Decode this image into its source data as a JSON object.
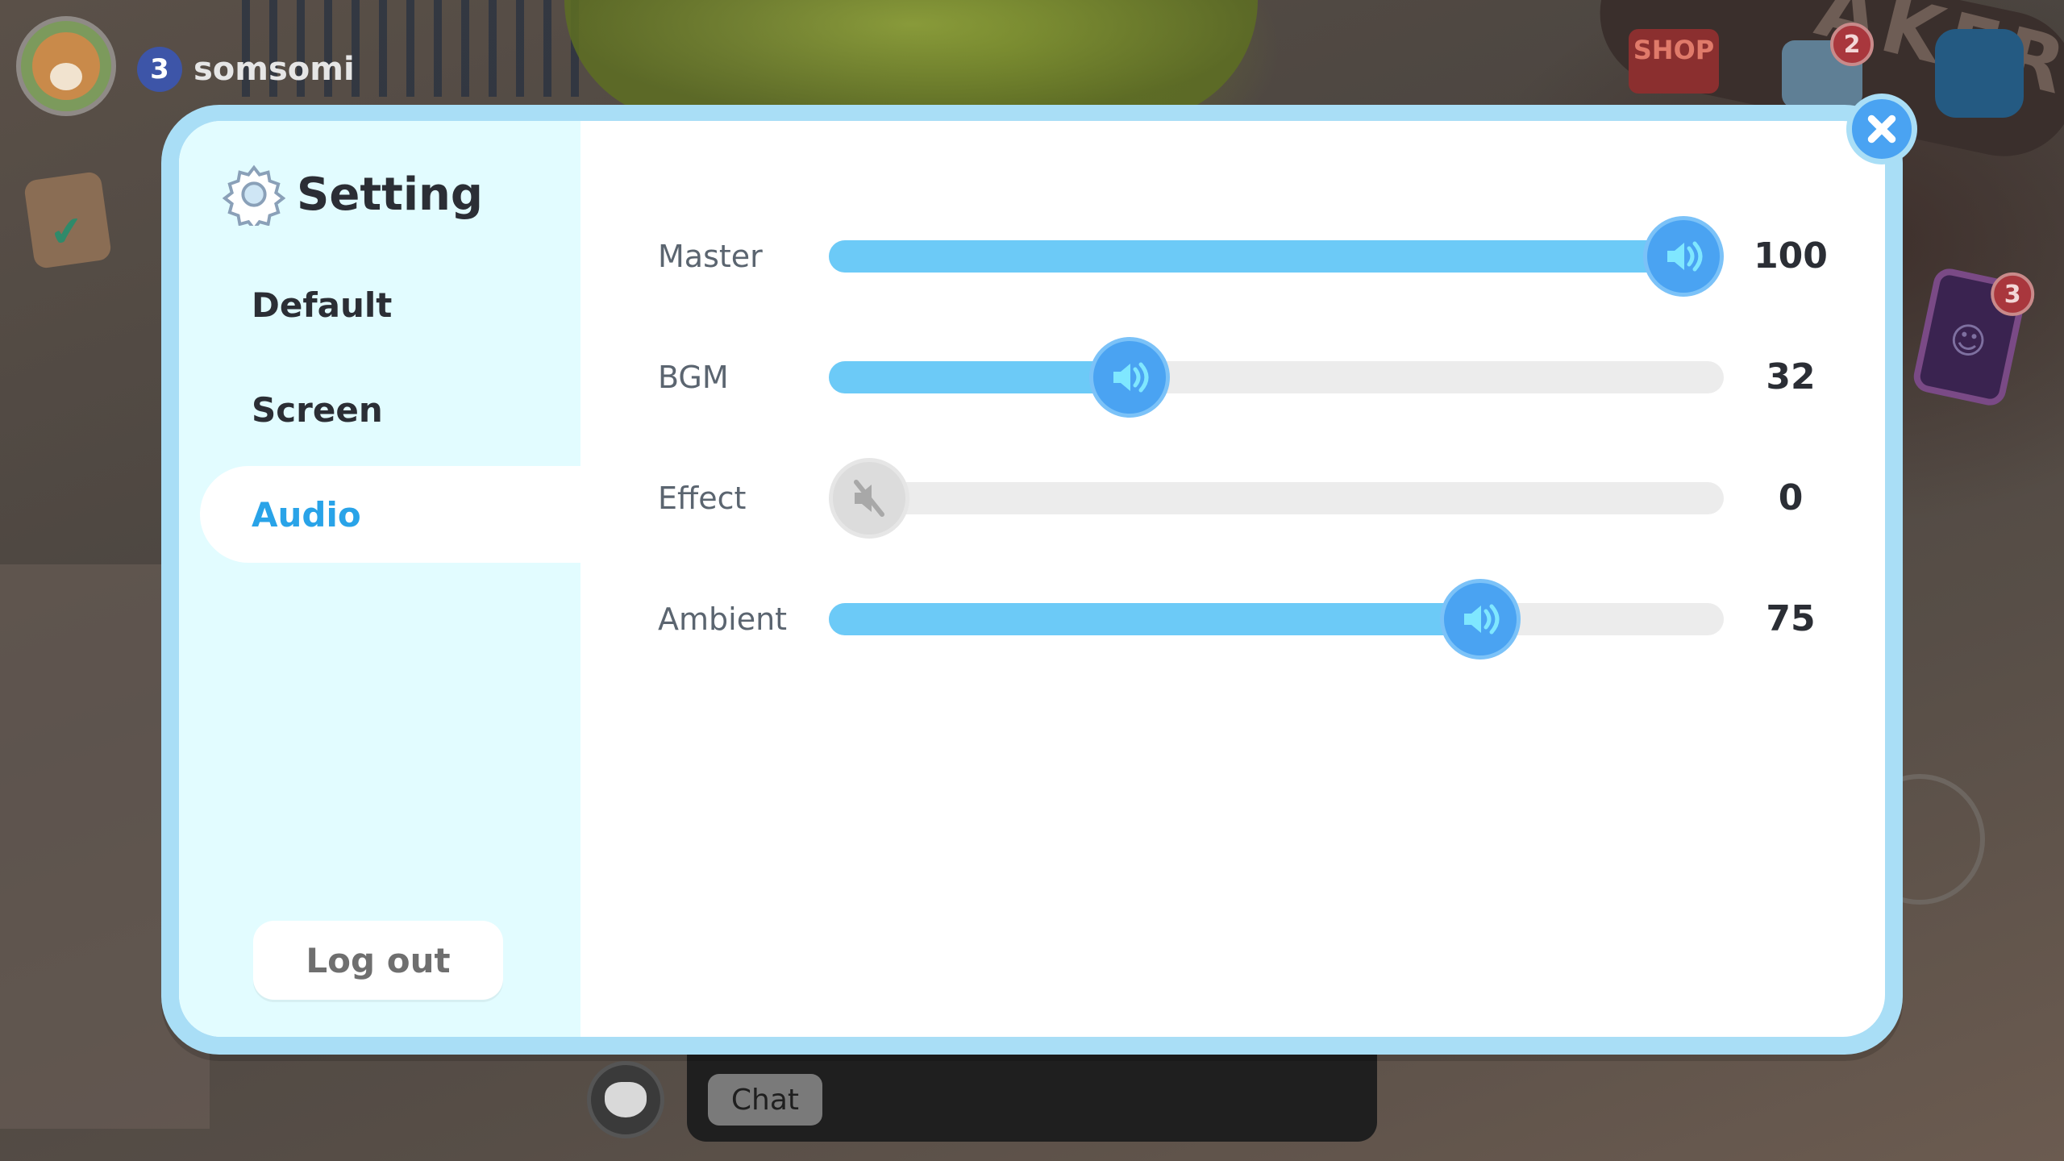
{
  "hud": {
    "player_level": "3",
    "player_name": "somsomi",
    "shop_label": "SHOP",
    "mail_badge": "2",
    "phone_badge": "3",
    "bakery_sign": "AKERY"
  },
  "chat": {
    "chip_label": "Chat"
  },
  "dialog": {
    "title": "Setting",
    "nav": [
      {
        "label": "Default",
        "active": false
      },
      {
        "label": "Screen",
        "active": false
      },
      {
        "label": "Audio",
        "active": true
      }
    ],
    "logout_label": "Log out"
  },
  "audio": [
    {
      "label": "Master",
      "value": 100,
      "display": "100",
      "muted": false
    },
    {
      "label": "BGM",
      "value": 32,
      "display": "32",
      "muted": false
    },
    {
      "label": "Effect",
      "value": 0,
      "display": "0",
      "muted": true
    },
    {
      "label": "Ambient",
      "value": 75,
      "display": "75",
      "muted": false
    }
  ],
  "colors": {
    "accent": "#29a3e8",
    "slider_fill": "#6ccaf7",
    "slider_thumb": "#4aa3f2",
    "frame": "#a9def6",
    "sidebar_bg": "#e2fcff"
  }
}
